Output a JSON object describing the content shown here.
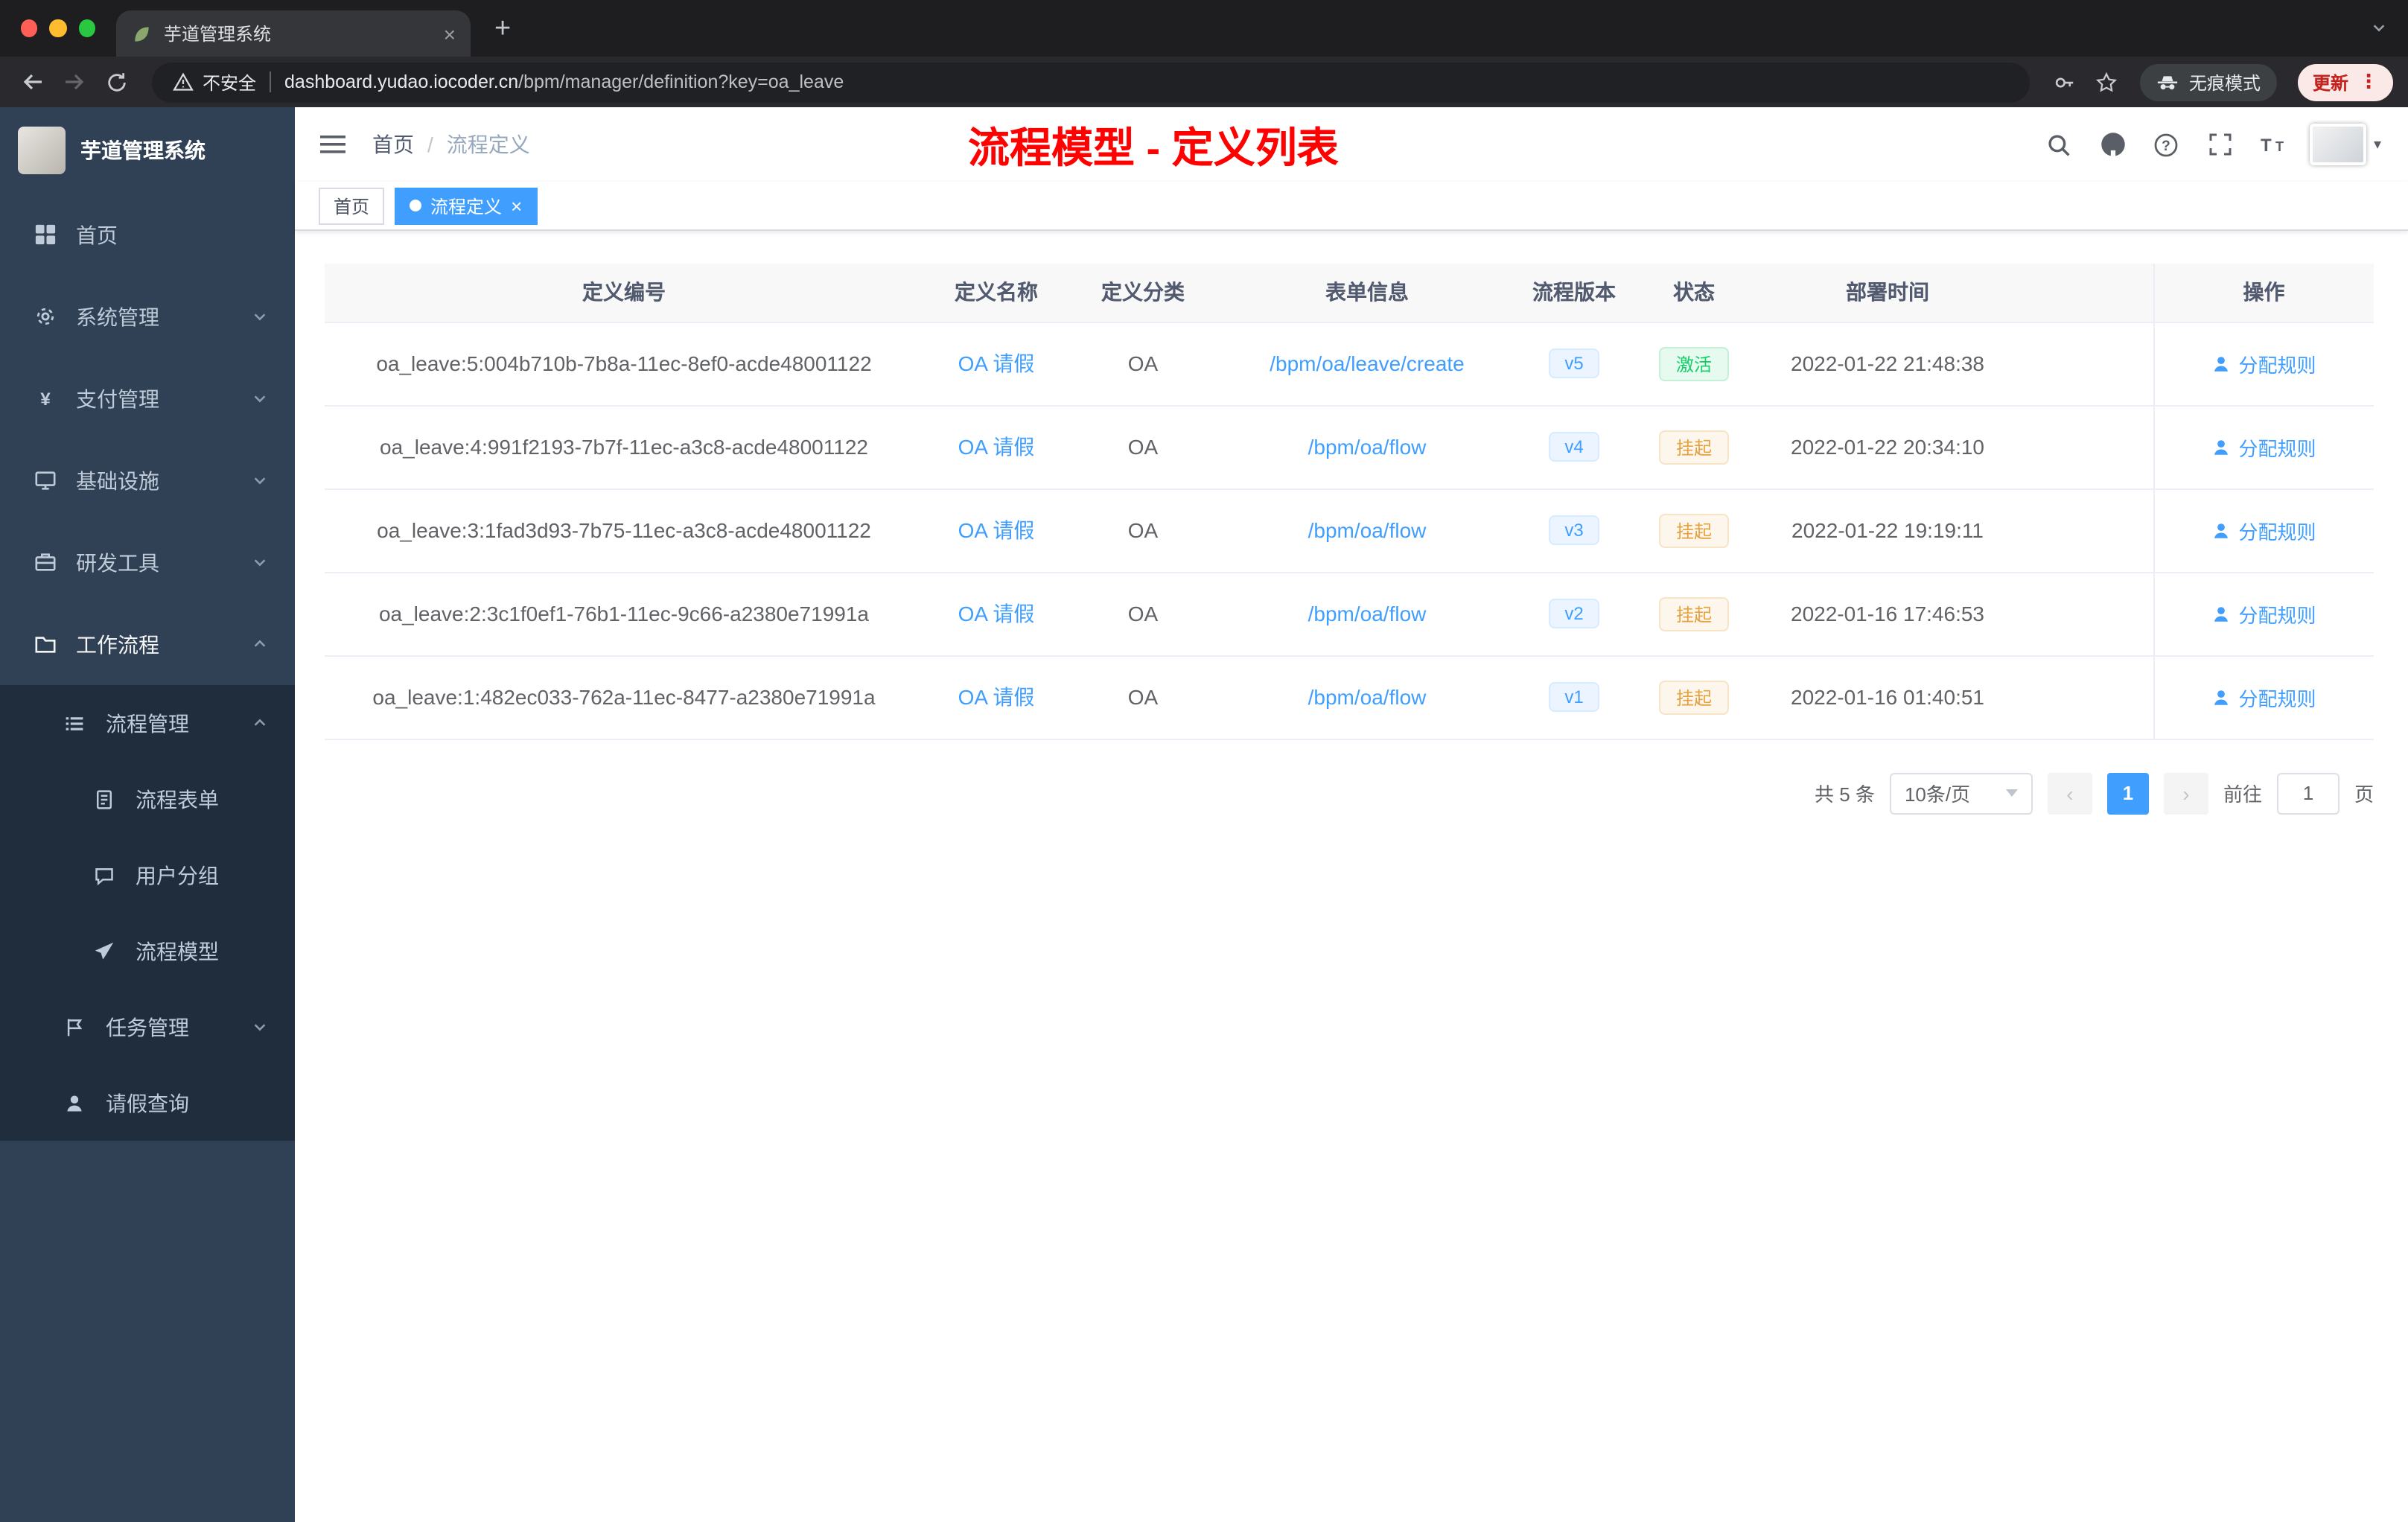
{
  "browser": {
    "tab": {
      "title": "芋道管理系统"
    },
    "address": {
      "security_label": "不安全",
      "url_domain": "dashboard.yudao.iocoder.cn",
      "url_path": "/bpm/manager/definition?key=oa_leave",
      "incognito_label": "无痕模式",
      "update_label": "更新"
    }
  },
  "icons": {
    "tab_close": "×",
    "new_tab": "+",
    "overflow_menu": "⋮",
    "prev_page": "‹",
    "next_page": "›",
    "avatar_caret": "▾",
    "breadcrumb_separator": "/"
  },
  "sidebar": {
    "app_title": "芋道管理系统",
    "menu": [
      {
        "label": "首页",
        "icon": "dashboard-icon",
        "arrow": ""
      },
      {
        "label": "系统管理",
        "icon": "gear-icon",
        "arrow": "down"
      },
      {
        "label": "支付管理",
        "icon": "yen-icon",
        "arrow": "down"
      },
      {
        "label": "基础设施",
        "icon": "monitor-icon",
        "arrow": "down"
      },
      {
        "label": "研发工具",
        "icon": "toolbox-icon",
        "arrow": "down"
      },
      {
        "label": "工作流程",
        "icon": "briefcase-icon",
        "arrow": "up",
        "active": true
      }
    ],
    "submenu": [
      {
        "label": "流程管理",
        "icon": "list-icon",
        "arrow": "up",
        "level": 1
      },
      {
        "label": "流程表单",
        "icon": "document-icon",
        "arrow": "",
        "level": 2
      },
      {
        "label": "用户分组",
        "icon": "chat-icon",
        "arrow": "",
        "level": 2
      },
      {
        "label": "流程模型",
        "icon": "send-icon",
        "arrow": "",
        "level": 2
      },
      {
        "label": "任务管理",
        "icon": "flag-icon",
        "arrow": "down",
        "level": 1
      },
      {
        "label": "请假查询",
        "icon": "user-icon",
        "arrow": "",
        "level": 1
      }
    ]
  },
  "navbar": {
    "breadcrumb": [
      "首页",
      "流程定义"
    ],
    "annotation": "流程模型 - 定义列表"
  },
  "tags_view": [
    {
      "label": "首页",
      "active": false,
      "closable": false
    },
    {
      "label": "流程定义",
      "active": true,
      "closable": true
    }
  ],
  "table": {
    "columns": [
      "定义编号",
      "定义名称",
      "定义分类",
      "表单信息",
      "流程版本",
      "状态",
      "部署时间",
      "操作"
    ],
    "rows": [
      {
        "id": "oa_leave:5:004b710b-7b8a-11ec-8ef0-acde48001122",
        "name": "OA 请假",
        "category": "OA",
        "form": "/bpm/oa/leave/create",
        "version": "v5",
        "status": "激活",
        "status_type": "success",
        "time": "2022-01-22 21:48:38",
        "action": "分配规则"
      },
      {
        "id": "oa_leave:4:991f2193-7b7f-11ec-a3c8-acde48001122",
        "name": "OA 请假",
        "category": "OA",
        "form": "/bpm/oa/flow",
        "version": "v4",
        "status": "挂起",
        "status_type": "warning",
        "time": "2022-01-22 20:34:10",
        "action": "分配规则"
      },
      {
        "id": "oa_leave:3:1fad3d93-7b75-11ec-a3c8-acde48001122",
        "name": "OA 请假",
        "category": "OA",
        "form": "/bpm/oa/flow",
        "version": "v3",
        "status": "挂起",
        "status_type": "warning",
        "time": "2022-01-22 19:19:11",
        "action": "分配规则"
      },
      {
        "id": "oa_leave:2:3c1f0ef1-76b1-11ec-9c66-a2380e71991a",
        "name": "OA 请假",
        "category": "OA",
        "form": "/bpm/oa/flow",
        "version": "v2",
        "status": "挂起",
        "status_type": "warning",
        "time": "2022-01-16 17:46:53",
        "action": "分配规则"
      },
      {
        "id": "oa_leave:1:482ec033-762a-11ec-8477-a2380e71991a",
        "name": "OA 请假",
        "category": "OA",
        "form": "/bpm/oa/flow",
        "version": "v1",
        "status": "挂起",
        "status_type": "warning",
        "time": "2022-01-16 01:40:51",
        "action": "分配规则"
      }
    ]
  },
  "pagination": {
    "total_label": "共 5 条",
    "page_size": "10条/页",
    "current_page": "1",
    "goto_label": "前往",
    "goto_value": "1",
    "page_unit": "页"
  },
  "colors": {
    "accent": "#409eff",
    "annotation_red": "#fe0100",
    "status_active": "#13ce66",
    "status_suspended": "#e6a23c",
    "sidebar_bg": "#304156",
    "submenu_bg": "#1f2d3d",
    "traffic_red": "#ff5f57",
    "traffic_yellow": "#febc2e",
    "traffic_green": "#28c840"
  }
}
